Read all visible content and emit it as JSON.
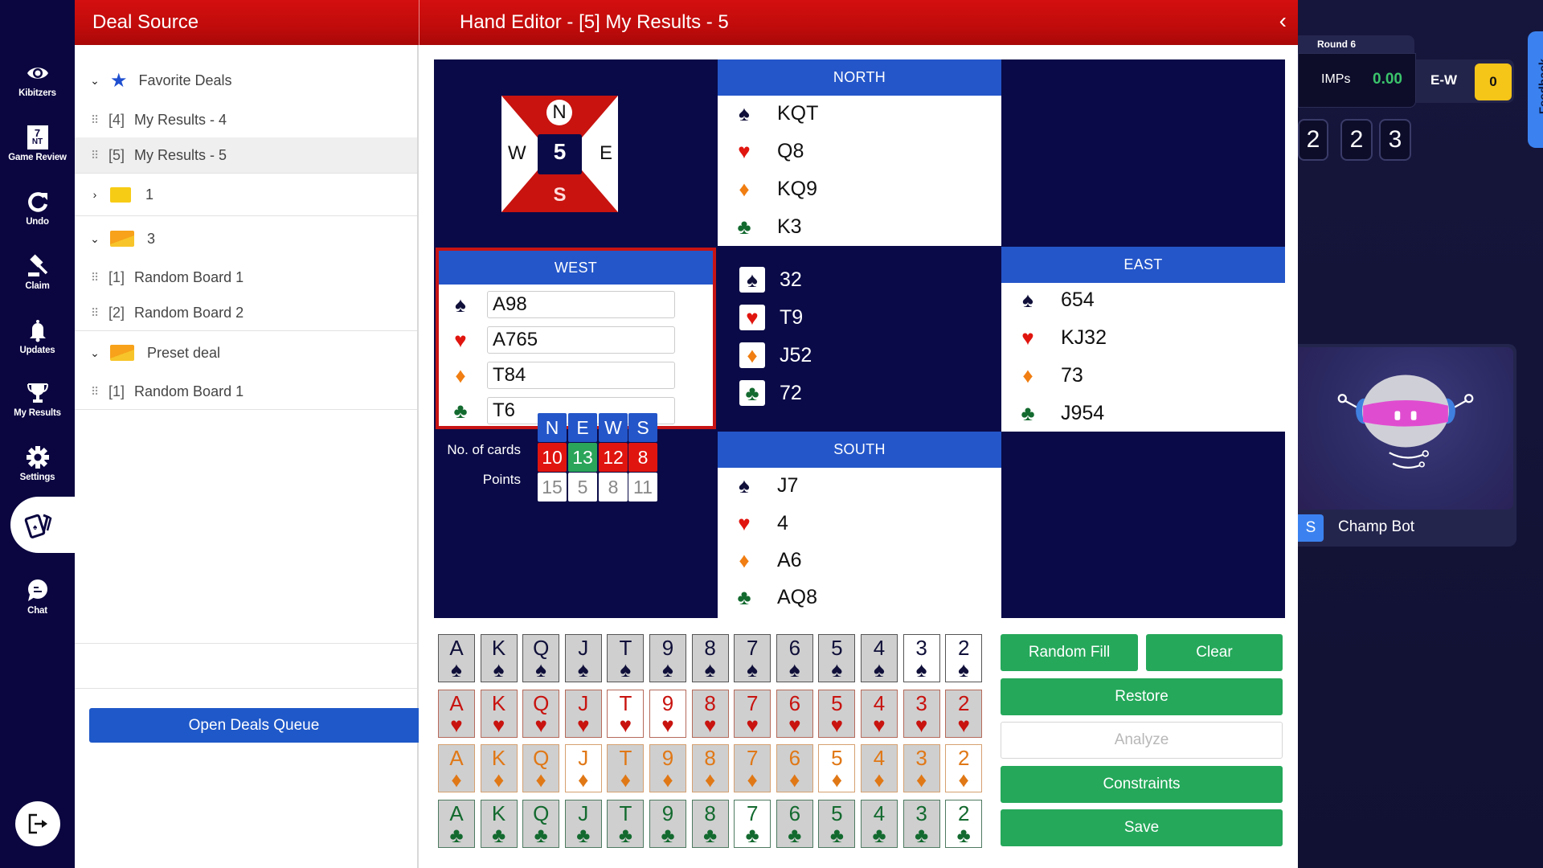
{
  "sidebar": {
    "items": [
      {
        "label": "Kibitzers",
        "icon": "eye-icon"
      },
      {
        "label": "Game Review",
        "icon": "game-review-icon"
      },
      {
        "label": "Undo",
        "icon": "undo-icon"
      },
      {
        "label": "Claim",
        "icon": "gavel-icon"
      },
      {
        "label": "Updates",
        "icon": "bell-icon"
      },
      {
        "label": "My Results",
        "icon": "trophy-icon"
      },
      {
        "label": "Settings",
        "icon": "gear-icon"
      },
      {
        "label": "",
        "icon": "cards-icon",
        "active": true
      },
      {
        "label": "Chat",
        "icon": "chat-icon"
      }
    ],
    "game_review_badge": {
      "top": "7",
      "bottom": "NT"
    },
    "logout_icon": "logout-icon"
  },
  "deal_source": {
    "title": "Deal Source",
    "tree": [
      {
        "type": "group",
        "expanded": true,
        "icon": "star-icon",
        "label": "Favorite Deals"
      },
      {
        "type": "deal",
        "index": "[4]",
        "label": "My Results - 4",
        "selected": false
      },
      {
        "type": "deal",
        "index": "[5]",
        "label": "My Results - 5",
        "selected": true
      },
      {
        "type": "folder",
        "expanded": false,
        "label": "1"
      },
      {
        "type": "folder",
        "expanded": true,
        "label": "3"
      },
      {
        "type": "deal",
        "index": "[1]",
        "label": "Random Board 1",
        "selected": false
      },
      {
        "type": "deal",
        "index": "[2]",
        "label": "Random Board 2",
        "selected": false
      },
      {
        "type": "folder",
        "expanded": true,
        "label": "Preset deal"
      },
      {
        "type": "deal",
        "index": "[1]",
        "label": "Random Board 1",
        "selected": false
      }
    ],
    "open_queue_label": "Open Deals Queue"
  },
  "hand_editor": {
    "title": "Hand Editor - [5] My Results - 5",
    "collapse_icon": "chevron-left-icon",
    "board_number": "5",
    "compass": {
      "n": "N",
      "s": "S",
      "e": "E",
      "w": "W"
    },
    "hands": {
      "north": {
        "label": "NORTH",
        "spades": "KQT",
        "hearts": "Q8",
        "diamonds": "KQ9",
        "clubs": "K3"
      },
      "east": {
        "label": "EAST",
        "spades": "654",
        "hearts": "KJ32",
        "diamonds": "73",
        "clubs": "J954"
      },
      "south": {
        "label": "SOUTH",
        "spades": "J7",
        "hearts": "4",
        "diamonds": "A6",
        "clubs": "AQ8"
      },
      "west": {
        "label": "WEST",
        "spades": "A98",
        "hearts": "A765",
        "diamonds": "T84",
        "clubs": "T6"
      }
    },
    "unassigned": {
      "spades": "32",
      "hearts": "T9",
      "diamonds": "J52",
      "clubs": "72"
    },
    "stats": {
      "headers": [
        "N",
        "E",
        "W",
        "S"
      ],
      "cards_label": "No. of cards",
      "cards": [
        "10",
        "13",
        "12",
        "8"
      ],
      "cards_status": [
        "bad",
        "ok",
        "bad",
        "bad"
      ],
      "points_label": "Points",
      "points": [
        "15",
        "5",
        "8",
        "11"
      ]
    },
    "deck": {
      "ranks": [
        "A",
        "K",
        "Q",
        "J",
        "T",
        "9",
        "8",
        "7",
        "6",
        "5",
        "4",
        "3",
        "2"
      ],
      "suits": [
        {
          "name": "spades",
          "symbol": "♠",
          "available": [
            "3",
            "2"
          ]
        },
        {
          "name": "hearts",
          "symbol": "♥",
          "available": [
            "T",
            "9"
          ]
        },
        {
          "name": "diamonds",
          "symbol": "♦",
          "available": [
            "J",
            "5",
            "2"
          ]
        },
        {
          "name": "clubs",
          "symbol": "♣",
          "available": [
            "7",
            "2"
          ]
        }
      ]
    },
    "buttons": {
      "random_fill": "Random Fill",
      "clear": "Clear",
      "restore": "Restore",
      "analyze": "Analyze",
      "constraints": "Constraints",
      "save": "Save"
    }
  },
  "scoreboard": {
    "round_label": "Round 6",
    "imps_label": "IMPs",
    "imps_value": "0.00",
    "side_label": "E-W",
    "side_score": "0",
    "tricks": [
      "2",
      "2",
      "3"
    ],
    "feedback_label": "Feedback"
  },
  "player_card": {
    "seat": "S",
    "name": "Champ Bot"
  },
  "colors": {
    "header_red": "#c80c0c",
    "hand_header_blue": "#2456c9",
    "button_green": "#25a85a",
    "board_navy": "#0a0a48",
    "sidebar_navy": "#0b0640",
    "imps_green": "#3bc46b",
    "score_yellow": "#f5c518"
  }
}
